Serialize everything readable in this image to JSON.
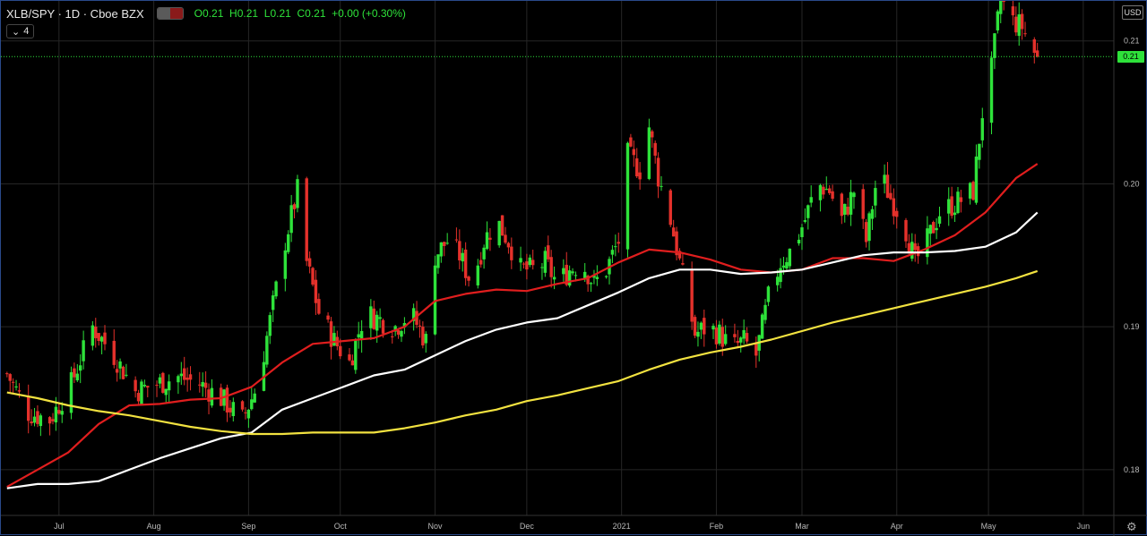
{
  "header": {
    "symbol": "XLB/SPY · 1D · Cboe BZX",
    "ohlc": {
      "o_label": "O",
      "o": "0.21",
      "h_label": "H",
      "h": "0.21",
      "l_label": "L",
      "l": "0.21",
      "c_label": "C",
      "c": "0.21",
      "change": "+0.00 (+0.30%)"
    },
    "indicator_count": "4"
  },
  "currency": "USD",
  "last_price_label": "0.21",
  "colors": {
    "up": "#2ee23a",
    "down": "#e5312b",
    "ma_red": "#e01e1e",
    "ma_white": "#ffffff",
    "ma_yellow": "#f2e240",
    "grid": "#262626"
  },
  "chart_data": {
    "type": "candlestick",
    "title": "",
    "xlabel": "",
    "ylabel": "",
    "ylim": [
      0.1768,
      0.2128
    ],
    "yticks": [
      0.18,
      0.19,
      0.2,
      0.21
    ],
    "yticklabels": [
      "0.18",
      "0.19",
      "0.20",
      "0.21"
    ],
    "xticks": [
      {
        "label": "Jul",
        "day": 17
      },
      {
        "label": "Aug",
        "day": 48
      },
      {
        "label": "Sep",
        "day": 79
      },
      {
        "label": "Oct",
        "day": 109
      },
      {
        "label": "Nov",
        "day": 140
      },
      {
        "label": "Dec",
        "day": 170
      },
      {
        "label": "2021",
        "day": 201
      },
      {
        "label": "Feb",
        "day": 232
      },
      {
        "label": "Mar",
        "day": 260
      },
      {
        "label": "Apr",
        "day": 291
      },
      {
        "label": "May",
        "day": 321
      },
      {
        "label": "Jun",
        "day": 352
      }
    ],
    "start_date": "2020-06-14",
    "last_close": 0.2089,
    "closes": [
      [
        0,
        0.1867
      ],
      [
        7,
        0.184
      ],
      [
        14,
        0.1835
      ],
      [
        21,
        0.186
      ],
      [
        28,
        0.19
      ],
      [
        35,
        0.188
      ],
      [
        42,
        0.1855
      ],
      [
        49,
        0.186
      ],
      [
        56,
        0.1865
      ],
      [
        63,
        0.186
      ],
      [
        70,
        0.185
      ],
      [
        77,
        0.1835
      ],
      [
        82,
        0.186
      ],
      [
        87,
        0.1915
      ],
      [
        91,
        0.196
      ],
      [
        95,
        0.1995
      ],
      [
        98,
        0.1945
      ],
      [
        102,
        0.191
      ],
      [
        107,
        0.189
      ],
      [
        112,
        0.1875
      ],
      [
        117,
        0.191
      ],
      [
        122,
        0.1905
      ],
      [
        127,
        0.19
      ],
      [
        132,
        0.191
      ],
      [
        137,
        0.189
      ],
      [
        140,
        0.195
      ],
      [
        144,
        0.196
      ],
      [
        148,
        0.195
      ],
      [
        152,
        0.193
      ],
      [
        156,
        0.196
      ],
      [
        160,
        0.1975
      ],
      [
        164,
        0.196
      ],
      [
        168,
        0.194
      ],
      [
        172,
        0.194
      ],
      [
        176,
        0.1945
      ],
      [
        180,
        0.193
      ],
      [
        184,
        0.194
      ],
      [
        188,
        0.1945
      ],
      [
        192,
        0.193
      ],
      [
        196,
        0.194
      ],
      [
        200,
        0.196
      ],
      [
        203,
        0.202
      ],
      [
        207,
        0.201
      ],
      [
        210,
        0.204
      ],
      [
        213,
        0.2005
      ],
      [
        217,
        0.1975
      ],
      [
        221,
        0.1935
      ],
      [
        225,
        0.1895
      ],
      [
        229,
        0.19
      ],
      [
        233,
        0.1895
      ],
      [
        237,
        0.1885
      ],
      [
        241,
        0.189
      ],
      [
        245,
        0.188
      ],
      [
        249,
        0.192
      ],
      [
        253,
        0.1945
      ],
      [
        257,
        0.1955
      ],
      [
        261,
        0.1975
      ],
      [
        265,
        0.2
      ],
      [
        269,
        0.1995
      ],
      [
        273,
        0.1975
      ],
      [
        277,
        0.1995
      ],
      [
        281,
        0.196
      ],
      [
        285,
        0.201
      ],
      [
        289,
        0.199
      ],
      [
        293,
        0.1975
      ],
      [
        297,
        0.1945
      ],
      [
        301,
        0.196
      ],
      [
        305,
        0.198
      ],
      [
        309,
        0.1985
      ],
      [
        313,
        0.199
      ],
      [
        316,
        0.1995
      ],
      [
        319,
        0.205
      ],
      [
        322,
        0.208
      ],
      [
        325,
        0.213
      ],
      [
        328,
        0.2115
      ],
      [
        332,
        0.211
      ],
      [
        335,
        0.2095
      ],
      [
        337,
        0.2089
      ]
    ],
    "series": [
      {
        "name": "",
        "color": "#e01e1e",
        "x": [
          0,
          10,
          20,
          30,
          40,
          50,
          60,
          70,
          80,
          90,
          100,
          110,
          120,
          130,
          140,
          150,
          160,
          170,
          180,
          190,
          200,
          210,
          220,
          230,
          240,
          250,
          260,
          270,
          280,
          290,
          300,
          310,
          320,
          330,
          337
        ],
        "y": [
          0.1788,
          0.18,
          0.1812,
          0.1832,
          0.1845,
          0.1846,
          0.1849,
          0.185,
          0.1858,
          0.1875,
          0.1888,
          0.189,
          0.1892,
          0.19,
          0.1918,
          0.1923,
          0.1926,
          0.1925,
          0.193,
          0.1934,
          0.1945,
          0.1954,
          0.1952,
          0.1947,
          0.194,
          0.1938,
          0.194,
          0.1948,
          0.1948,
          0.1946,
          0.1954,
          0.1964,
          0.198,
          0.2004,
          0.2014
        ]
      },
      {
        "name": "",
        "color": "#ffffff",
        "x": [
          0,
          10,
          20,
          30,
          40,
          50,
          60,
          70,
          80,
          90,
          100,
          110,
          120,
          130,
          140,
          150,
          160,
          170,
          180,
          190,
          200,
          210,
          220,
          230,
          240,
          250,
          260,
          270,
          280,
          290,
          300,
          310,
          320,
          330,
          337
        ],
        "y": [
          0.1787,
          0.179,
          0.179,
          0.1792,
          0.18,
          0.1808,
          0.1815,
          0.1822,
          0.1826,
          0.1842,
          0.185,
          0.1858,
          0.1866,
          0.187,
          0.188,
          0.189,
          0.1898,
          0.1903,
          0.1906,
          0.1915,
          0.1924,
          0.1934,
          0.194,
          0.194,
          0.1937,
          0.1938,
          0.194,
          0.1945,
          0.195,
          0.1952,
          0.1952,
          0.1953,
          0.1956,
          0.1966,
          0.198
        ]
      },
      {
        "name": "",
        "color": "#f2e240",
        "x": [
          0,
          10,
          20,
          30,
          40,
          50,
          60,
          70,
          80,
          90,
          100,
          110,
          120,
          130,
          140,
          150,
          160,
          170,
          180,
          190,
          200,
          210,
          220,
          230,
          240,
          250,
          260,
          270,
          280,
          290,
          300,
          310,
          320,
          330,
          337
        ],
        "y": [
          0.1854,
          0.185,
          0.1845,
          0.1841,
          0.1838,
          0.1834,
          0.183,
          0.1827,
          0.1825,
          0.1825,
          0.1826,
          0.1826,
          0.1826,
          0.1829,
          0.1833,
          0.1838,
          0.1842,
          0.1848,
          0.1852,
          0.1857,
          0.1862,
          0.187,
          0.1877,
          0.1882,
          0.1886,
          0.1891,
          0.1897,
          0.1903,
          0.1908,
          0.1913,
          0.1918,
          0.1923,
          0.1928,
          0.1934,
          0.1939
        ]
      }
    ]
  }
}
